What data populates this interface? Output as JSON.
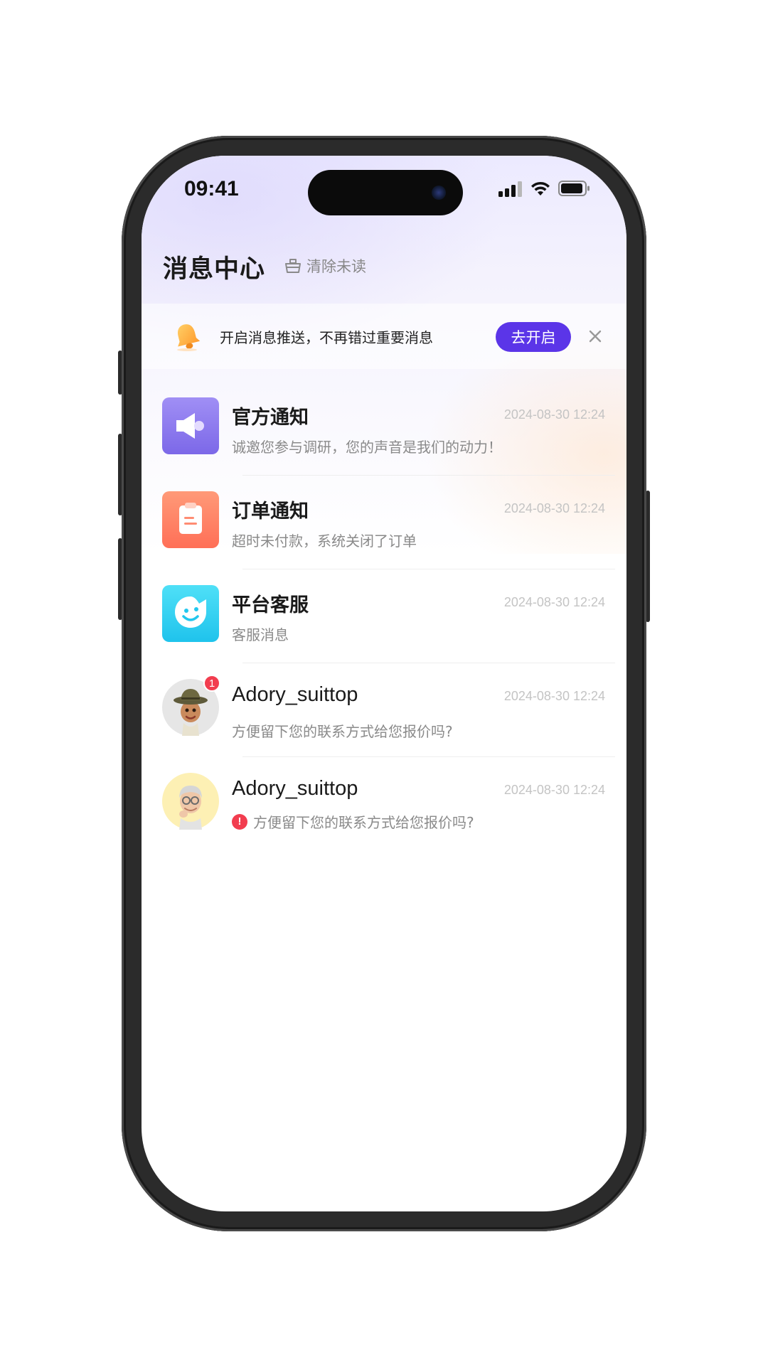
{
  "status_bar": {
    "time": "09:41"
  },
  "header": {
    "title": "消息中心",
    "clear_label": "清除未读"
  },
  "push_banner": {
    "text": "开启消息推送，不再错过重要消息",
    "button": "去开启"
  },
  "messages": [
    {
      "title": "官方通知",
      "time": "2024-08-30 12:24",
      "preview": "诚邀您参与调研，您的声音是我们的动力！",
      "icon": "megaphone-icon",
      "color": "#8e7cf0"
    },
    {
      "title": "订单通知",
      "time": "2024-08-30 12:24",
      "preview": "超时未付款，系统关闭了订单",
      "icon": "clipboard-icon",
      "color": "#ff7e63"
    },
    {
      "title": "平台客服",
      "time": "2024-08-30 12:24",
      "preview": "客服消息",
      "icon": "service-face-icon",
      "color": "#2ed3f2"
    },
    {
      "title": "Adory_suittop",
      "time": "2024-08-30 12:24",
      "preview": "方便留下您的联系方式给您报价吗?",
      "icon": "memoji-explorer-avatar",
      "badge": "1"
    },
    {
      "title": "Adory_suittop",
      "time": "2024-08-30 12:24",
      "preview": "方便留下您的联系方式给您报价吗?",
      "icon": "memoji-elder-avatar",
      "status": "send-failed-icon"
    }
  ],
  "colors": {
    "accent": "#5b35e8",
    "badge": "#f23d4f"
  }
}
